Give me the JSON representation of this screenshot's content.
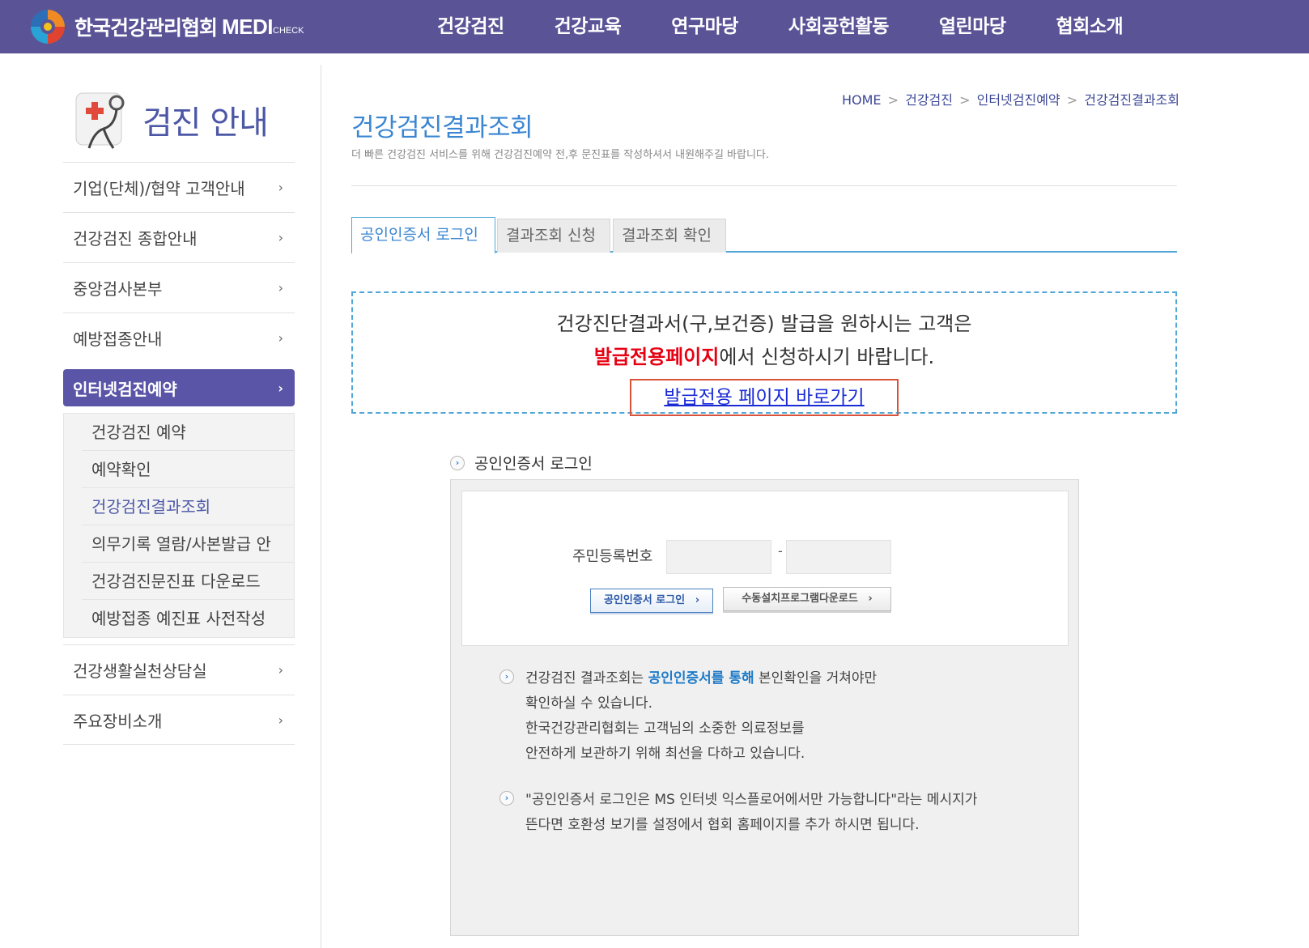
{
  "header": {
    "logo_text": "한국건강관리협회",
    "logo_brand": "MEDI",
    "logo_brand_sub": "CHECK",
    "nav": [
      "건강검진",
      "건강교육",
      "연구마당",
      "사회공헌활동",
      "열린마당",
      "협회소개"
    ]
  },
  "sidebar": {
    "title": "검진 안내",
    "items": [
      {
        "label": "기업(단체)/협약 고객안내"
      },
      {
        "label": "건강검진 종합안내"
      },
      {
        "label": "중앙검사본부"
      },
      {
        "label": "예방접종안내"
      },
      {
        "label": "인터넷검진예약"
      }
    ],
    "sub_items": [
      {
        "label": "건강검진 예약"
      },
      {
        "label": "예약확인"
      },
      {
        "label": "건강검진결과조회"
      },
      {
        "label": "의무기록 열람/사본발급 안"
      },
      {
        "label": "건강검진문진표 다운로드"
      },
      {
        "label": "예방접종 예진표 사전작성"
      }
    ],
    "bottom_items": [
      {
        "label": "건강생활실천상담실"
      },
      {
        "label": "주요장비소개"
      }
    ],
    "chevron": "›"
  },
  "breadcrumb": {
    "home": "HOME",
    "items": [
      "건강검진",
      "인터넷검진예약",
      "건강검진결과조회"
    ],
    "separator": ">"
  },
  "page": {
    "title": "건강검진결과조회",
    "description": "더 빠른 건강검진 서비스를 위해 건강검진예약 전,후 문진표를 작성하셔서 내원해주길 바랍니다."
  },
  "tabs": [
    {
      "label": "공인인증서 로그인",
      "active": true
    },
    {
      "label": "결과조회 신청",
      "active": false
    },
    {
      "label": "결과조회 확인",
      "active": false
    }
  ],
  "notice": {
    "line1": "건강진단결과서(구,보건증) 발급을 원하시는 고객은",
    "line2_highlight": "발급전용페이지",
    "line2_rest": "에서 신청하시기 바랍니다.",
    "link_label": "발급전용 페이지 바로가기"
  },
  "login": {
    "section_label": "공인인증서 로그인",
    "ssn_label": "주민등록번호",
    "ssn_dash": "-",
    "ssn_front_value": "",
    "ssn_back_value": "",
    "cert_button": "공인인증서 로그인",
    "manual_button": "수동설치프로그램다운로드",
    "button_arrow": "›"
  },
  "info": {
    "block1_pre": "건강검진 결과조회는 ",
    "block1_highlight": "공인인증서를 통해",
    "block1_post": " 본인확인을 거쳐야만",
    "block1_line2": "확인하실 수 있습니다.",
    "block1_line3": "한국건강관리협회는 고객님의 소중한 의료정보를",
    "block1_line4": "안전하게 보관하기 위해 최선을 다하고 있습니다.",
    "block2_line1": "\"공인인증서 로그인은 MS 인터넷 익스플로어에서만 가능합니다\"라는 메시지가",
    "block2_line2": "뜬다면 호환성 보기를 설정에서 협회 홈페이지를 추가 하시면 됩니다."
  },
  "colors": {
    "header_bg": "#5a5497",
    "accent_blue": "#3b86d2",
    "tab_border": "#51a6d8",
    "highlight_red": "#e60012",
    "link_blue": "#1a2bd6",
    "active_menu": "#5b55a8"
  }
}
